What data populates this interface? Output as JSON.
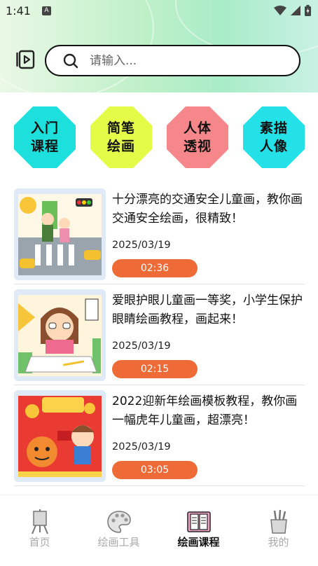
{
  "status_bar": {
    "time": "1:41",
    "a_badge": "A"
  },
  "search": {
    "placeholder": "请输入..."
  },
  "categories": [
    {
      "line1": "入门",
      "line2": "课程",
      "color": "#1de0dc"
    },
    {
      "line1": "简笔",
      "line2": "绘画",
      "color": "#e4fb48"
    },
    {
      "line1": "人体",
      "line2": "透视",
      "color": "#f5868a"
    },
    {
      "line1": "素描",
      "line2": "人像",
      "color": "#24e1e8"
    }
  ],
  "courses": [
    {
      "title": "十分漂亮的交通安全儿童画，教你画交通安全绘画，很精致！",
      "date": "2025/03/19",
      "duration": "02:36"
    },
    {
      "title": "爱眼护眼儿童画一等奖，小学生保护眼睛绘画教程，画起来！",
      "date": "2025/03/19",
      "duration": "02:15"
    },
    {
      "title": "2022迎新年绘画模板教程，教你画一幅虎年儿童画，超漂亮！",
      "date": "2025/03/19",
      "duration": "03:05"
    }
  ],
  "nav": [
    {
      "label": "首页"
    },
    {
      "label": "绘画工具"
    },
    {
      "label": "绘画课程",
      "active": true
    },
    {
      "label": "我的"
    }
  ],
  "colors": {
    "accent_orange": "#ee6a36",
    "header_green": "#bff0c8"
  }
}
